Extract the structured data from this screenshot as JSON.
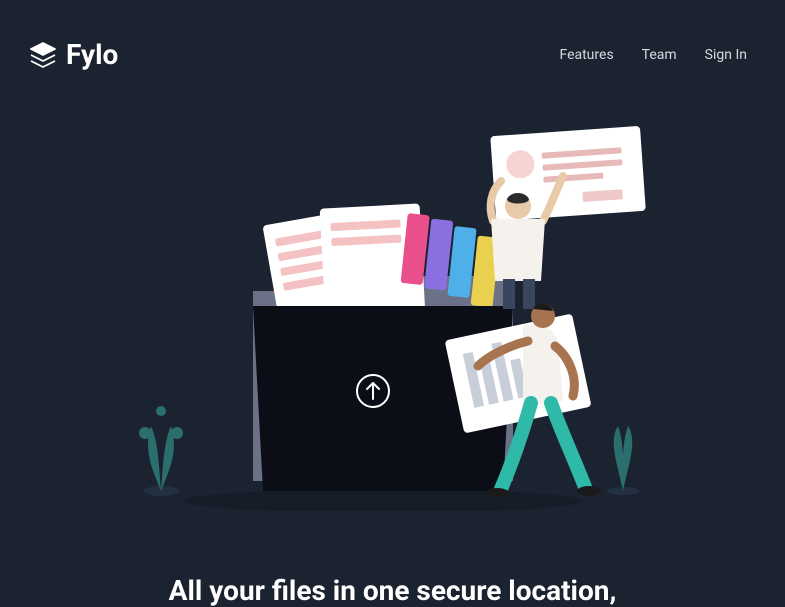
{
  "brand": {
    "name": "Fylo"
  },
  "nav": {
    "features": "Features",
    "team": "Team",
    "signin": "Sign In"
  },
  "hero": {
    "headline": "All your files in one secure location,"
  }
}
